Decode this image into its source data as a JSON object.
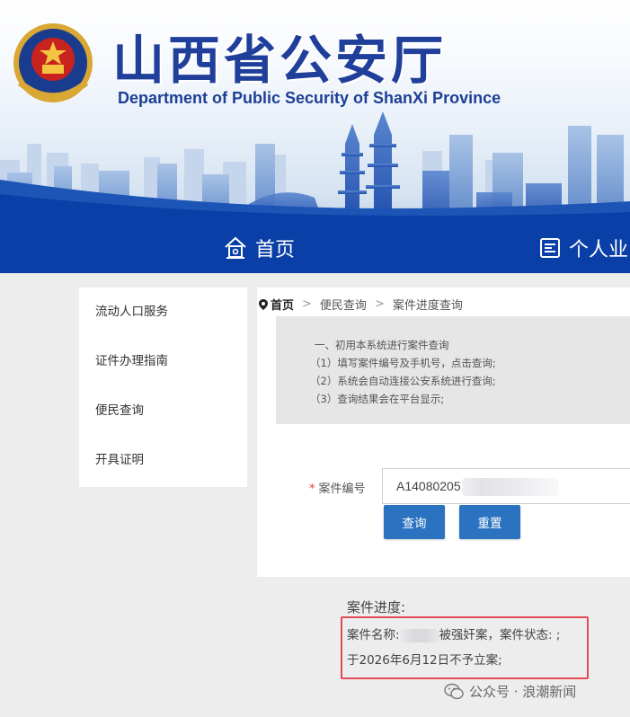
{
  "header": {
    "title_cn": "山西省公安厅",
    "title_en": "Department of Public Security of ShanXi Province",
    "emblem_icon": "police-emblem-icon"
  },
  "nav": {
    "home_label": "首页",
    "home_icon": "home-icon",
    "personal_label": "个人业",
    "personal_icon": "id-card-icon"
  },
  "sidebar": {
    "items": [
      {
        "label": "流动人口服务"
      },
      {
        "label": "证件办理指南"
      },
      {
        "label": "便民查询"
      },
      {
        "label": "开具证明"
      }
    ]
  },
  "breadcrumb": {
    "home": "首页",
    "sep": ">",
    "level1": "便民查询",
    "level2": "案件进度查询"
  },
  "notice": {
    "lines": [
      "一、初用本系统进行案件查询",
      "（1）填写案件编号及手机号，点击查询;",
      "（2）系统会自动连接公安系统进行查询;",
      "（3）查询结果会在平台显示;"
    ]
  },
  "form": {
    "required_mark": "*",
    "case_label": "案件编号",
    "case_value": "A14080205",
    "query_button": "查询",
    "reset_button": "重置"
  },
  "result": {
    "title": "案件进度:",
    "line1_prefix": "案件名称:",
    "line1_suffix": "被强奸案，案件状态: ;",
    "line2": "于2026年6月12日不予立案;"
  },
  "watermark": {
    "text": "公众号 · 浪潮新闻"
  },
  "colors": {
    "nav_bg": "#0b3fa8",
    "title_blue": "#1f3f9a",
    "button_blue": "#2b73c0",
    "highlight_red": "#e24a55"
  }
}
